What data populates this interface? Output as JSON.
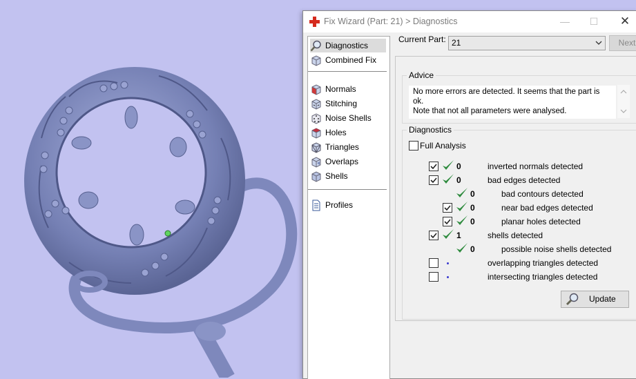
{
  "window": {
    "title": "Fix Wizard (Part: 21) > Diagnostics"
  },
  "sidebar": {
    "top_items": [
      {
        "label": "Diagnostics",
        "icon": "magnifier-icon",
        "selected": true
      },
      {
        "label": "Combined Fix",
        "icon": "cube-icon"
      }
    ],
    "fix_items": [
      {
        "label": "Normals",
        "icon": "normals-cube-icon"
      },
      {
        "label": "Stitching",
        "icon": "stitching-cube-icon"
      },
      {
        "label": "Noise Shells",
        "icon": "noise-shells-cube-icon"
      },
      {
        "label": "Holes",
        "icon": "holes-cube-icon"
      },
      {
        "label": "Triangles",
        "icon": "triangles-cube-icon"
      },
      {
        "label": "Overlaps",
        "icon": "overlaps-cube-icon"
      },
      {
        "label": "Shells",
        "icon": "shells-cube-icon"
      }
    ],
    "bottom_items": [
      {
        "label": "Profiles",
        "icon": "document-icon"
      }
    ]
  },
  "header": {
    "current_part_label": "Current Part:",
    "current_part_value": "21",
    "next_label": "Next"
  },
  "advice": {
    "title": "Advice",
    "text": "No more errors are detected. It seems that the part is ok.\nNote that not all parameters were analysed."
  },
  "diagnostics": {
    "title": "Diagnostics",
    "full_analysis_label": "Full Analysis",
    "full_analysis_checked": false,
    "rows": [
      {
        "checkbox": true,
        "checked": true,
        "status": "ok",
        "count": "0",
        "text": "inverted normals detected",
        "indent": 0
      },
      {
        "checkbox": true,
        "checked": true,
        "status": "ok",
        "count": "0",
        "text": "bad edges detected",
        "indent": 0
      },
      {
        "checkbox": false,
        "checked": false,
        "status": "ok",
        "count": "0",
        "text": "bad contours detected",
        "indent": 1
      },
      {
        "checkbox": true,
        "checked": true,
        "status": "ok",
        "count": "0",
        "text": "near bad edges detected",
        "indent": 1
      },
      {
        "checkbox": true,
        "checked": true,
        "status": "ok",
        "count": "0",
        "text": "planar holes detected",
        "indent": 1
      },
      {
        "checkbox": true,
        "checked": true,
        "status": "ok",
        "count": "1",
        "text": "shells detected",
        "indent": 0
      },
      {
        "checkbox": false,
        "checked": false,
        "status": "ok",
        "count": "0",
        "text": "possible noise shells detected",
        "indent": 1
      },
      {
        "checkbox": true,
        "checked": false,
        "status": "pending",
        "count": "",
        "text": "overlapping triangles detected",
        "indent": 0
      },
      {
        "checkbox": true,
        "checked": false,
        "status": "pending",
        "count": "",
        "text": "intersecting triangles detected",
        "indent": 0
      }
    ],
    "update_label": "Update"
  },
  "colors": {
    "viewport_background": "#c2c2f0",
    "model_color": "#8a94c2",
    "check_green": "#2e8b3e",
    "pending_dot": "#3a3acf"
  }
}
